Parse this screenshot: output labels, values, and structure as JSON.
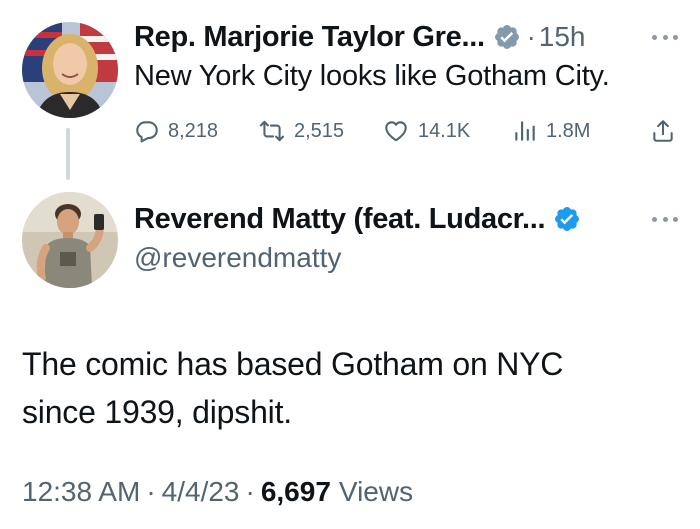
{
  "parent_tweet": {
    "display_name": "Rep. Marjorie Taylor Gre...",
    "time_separator": "·",
    "time_ago": "15h",
    "text": "New York City looks like Gotham City.",
    "stats": {
      "replies": "8,218",
      "retweets": "2,515",
      "likes": "14.1K",
      "views": "1.8M"
    },
    "badge_color": "#829aab"
  },
  "reply_tweet": {
    "display_name": "Reverend Matty (feat. Ludacr...",
    "handle": "@reverendmatty",
    "text_lines": [
      "The comic has based Gotham on NYC",
      "since 1939, dipshit."
    ],
    "time": "12:38 AM",
    "date": "4/4/23",
    "separator": "·",
    "views_count": "6,697",
    "views_label": "Views",
    "badge_color": "#1d9bf0"
  },
  "icons": {
    "reply": "reply-icon",
    "retweet": "retweet-icon",
    "like": "heart-icon",
    "views": "views-bar-chart-icon",
    "share": "share-icon",
    "more": "more-dots-icon",
    "verified": "verified-badge-icon"
  },
  "colors": {
    "text_primary": "#0f1419",
    "text_secondary": "#536471",
    "thread_line": "#cfd9de"
  }
}
